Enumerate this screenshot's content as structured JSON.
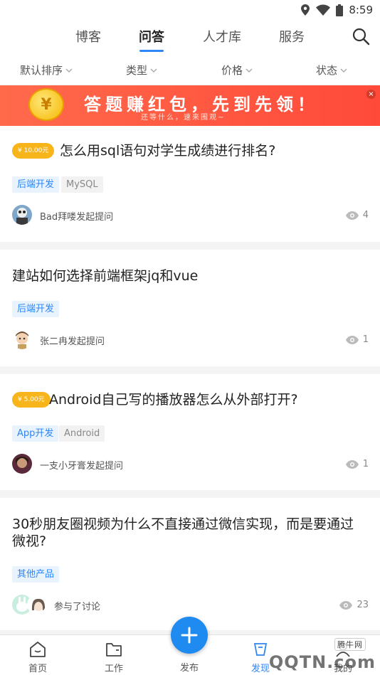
{
  "status_bar": {
    "time": "8:59"
  },
  "top_nav": {
    "tabs": [
      {
        "label": "博客"
      },
      {
        "label": "问答"
      },
      {
        "label": "人才库"
      },
      {
        "label": "服务"
      }
    ],
    "active_tab": "问答"
  },
  "filters": [
    {
      "label": "默认排序"
    },
    {
      "label": "类型"
    },
    {
      "label": "价格"
    },
    {
      "label": "状态"
    }
  ],
  "banner": {
    "coin_symbol": "¥",
    "title": "答题赚红包，先到先领！",
    "subtitle": "还等什么，速来围观~",
    "close_symbol": "×"
  },
  "questions": [
    {
      "bounty": "¥ 10.00元",
      "title": "怎么用sql语句对学生成绩进行排名?",
      "tags": [
        "后端开发",
        "MySQL"
      ],
      "author": "Bad拜喽发起提问",
      "views": "4"
    },
    {
      "bounty": "",
      "title": "建站如何选择前端框架jq和vue",
      "tags": [
        "后端开发"
      ],
      "author": "张二冉发起提问",
      "views": "1"
    },
    {
      "bounty": "¥ 5.00元",
      "title": "Android自己写的播放器怎么从外部打开?",
      "tags": [
        "App开发",
        "Android"
      ],
      "author": "一支小牙膏发起提问",
      "views": "1"
    },
    {
      "bounty": "",
      "title_line1": "30秒朋友圈视频为什么不直接通过微信实现，而是要通过",
      "title_line2": "微视?",
      "tags": [
        "其他产品"
      ],
      "author": "参与了讨论",
      "views": "23"
    }
  ],
  "bottom_nav": {
    "items": [
      {
        "label": "首页"
      },
      {
        "label": "工作"
      },
      {
        "label": "发布"
      },
      {
        "label": "发现"
      },
      {
        "label": "我的"
      }
    ]
  },
  "watermark": {
    "text": "QQTN.com",
    "badge": "腾牛网"
  },
  "colors": {
    "accent": "#2f86f6",
    "bounty": "#f7b51b",
    "banner": "#ff5a44"
  }
}
